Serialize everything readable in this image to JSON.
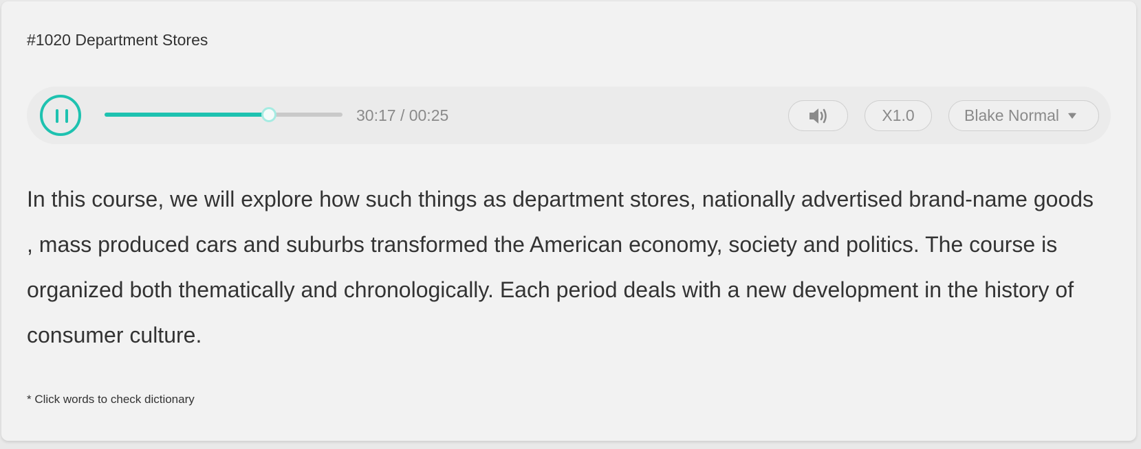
{
  "lesson": {
    "title": "#1020 Department Stores"
  },
  "player": {
    "state": "playing",
    "play_pause_icon": "pause-icon",
    "progress_fraction": 0.69,
    "time_display": "30:17 / 00:25",
    "volume_icon": "speaker-volume-icon",
    "speed_label": "X1.0",
    "voice_label": "Blake Normal",
    "voice_dropdown_icon": "caret-down-icon",
    "accent_color": "#1ec2b0"
  },
  "transcript": {
    "lines": [
      "In this course, we will explore how such things as department stores, nationally advertised brand-name goods",
      ", mass produced cars and suburbs transformed the American economy, society and politics. The course is",
      "organized both thematically and chronologically. Each period deals with a new development in the history of",
      "consumer culture."
    ]
  },
  "hint": "* Click words to check dictionary"
}
